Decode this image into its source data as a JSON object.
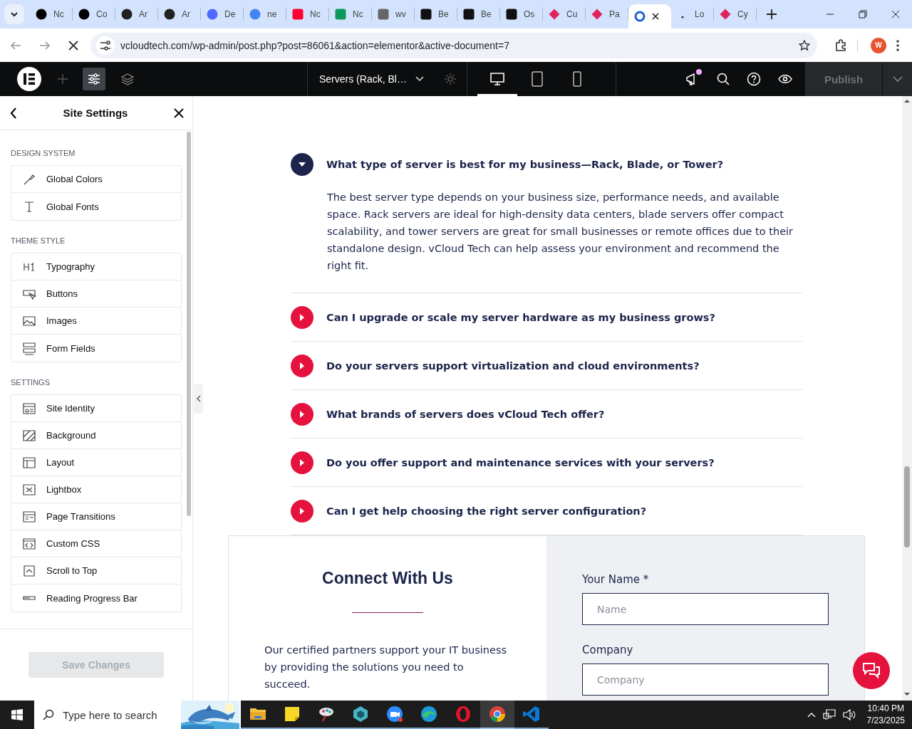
{
  "browser": {
    "tabs": [
      {
        "title": "Nc",
        "selected": false
      },
      {
        "title": "Co",
        "selected": false
      },
      {
        "title": "Ar",
        "selected": false
      },
      {
        "title": "Ar",
        "selected": false
      },
      {
        "title": "De",
        "selected": false
      },
      {
        "title": "ne",
        "selected": false
      },
      {
        "title": "Nc",
        "selected": false
      },
      {
        "title": "Nc",
        "selected": false
      },
      {
        "title": "wv",
        "selected": false
      },
      {
        "title": "Be",
        "selected": false
      },
      {
        "title": "Be",
        "selected": false
      },
      {
        "title": "Os",
        "selected": false
      },
      {
        "title": "Cu",
        "selected": false
      },
      {
        "title": "Pa",
        "selected": false
      },
      {
        "selected": true
      },
      {
        "title": "Lo",
        "selected": false
      },
      {
        "title": "Cy",
        "selected": false
      }
    ],
    "address": "vcloudtech.com/wp-admin/post.php?post=86061&action=elementor&active-document=7",
    "profile_initial": "W"
  },
  "editor": {
    "document_title": "Servers (Rack, Bl…",
    "devices": [
      {
        "selected": true
      },
      {
        "selected": false
      },
      {
        "selected": false
      }
    ],
    "has_notification": true,
    "publish": {
      "label": "Publish",
      "disabled": true
    }
  },
  "panel": {
    "title": "Site Settings",
    "sections": [
      {
        "label": "DESIGN SYSTEM",
        "items": [
          "Global Colors",
          "Global Fonts"
        ]
      },
      {
        "label": "THEME STYLE",
        "items": [
          "Typography",
          "Buttons",
          "Images",
          "Form Fields"
        ]
      },
      {
        "label": "SETTINGS",
        "items": [
          "Site Identity",
          "Background",
          "Layout",
          "Lightbox",
          "Page Transitions",
          "Custom CSS",
          "Scroll to Top",
          "Reading Progress Bar"
        ]
      }
    ],
    "save_button": {
      "label": "Save Changes",
      "disabled": true
    }
  },
  "faq": [
    {
      "question": "What type of server is best for my business—Rack, Blade, or Tower?",
      "expanded": true,
      "answer": "The best server type depends on your business size, performance needs, and available space. Rack servers are ideal for high-density data centers, blade servers offer compact scalability, and tower servers are great for small businesses or remote offices due to their standalone design. vCloud Tech can help assess your environment and recommend the right fit."
    },
    {
      "question": "Can I upgrade or scale my server hardware as my business grows?",
      "expanded": false
    },
    {
      "question": "Do your servers support virtualization and cloud environments?",
      "expanded": false
    },
    {
      "question": "What brands of servers does vCloud Tech offer?",
      "expanded": false
    },
    {
      "question": "Do you offer support and maintenance services with your servers?",
      "expanded": false
    },
    {
      "question": "Can I get help choosing the right server configuration?",
      "expanded": false
    }
  ],
  "contact": {
    "heading": "Connect With Us",
    "text": "Our certified partners support your IT business by providing the solutions you need to succeed.",
    "fields": [
      {
        "label": "Your Name *",
        "placeholder": "Name"
      },
      {
        "label": "Company",
        "placeholder": "Company"
      }
    ]
  },
  "taskbar": {
    "search_placeholder": "Type here to search",
    "apps": [
      {
        "selected": false
      },
      {
        "selected": false
      },
      {
        "selected": false
      },
      {
        "selected": false
      },
      {
        "selected": false
      },
      {
        "selected": false
      },
      {
        "selected": false
      },
      {
        "selected": true
      },
      {
        "selected": false
      }
    ],
    "time": "10:40 PM",
    "date": "7/23/2025"
  }
}
